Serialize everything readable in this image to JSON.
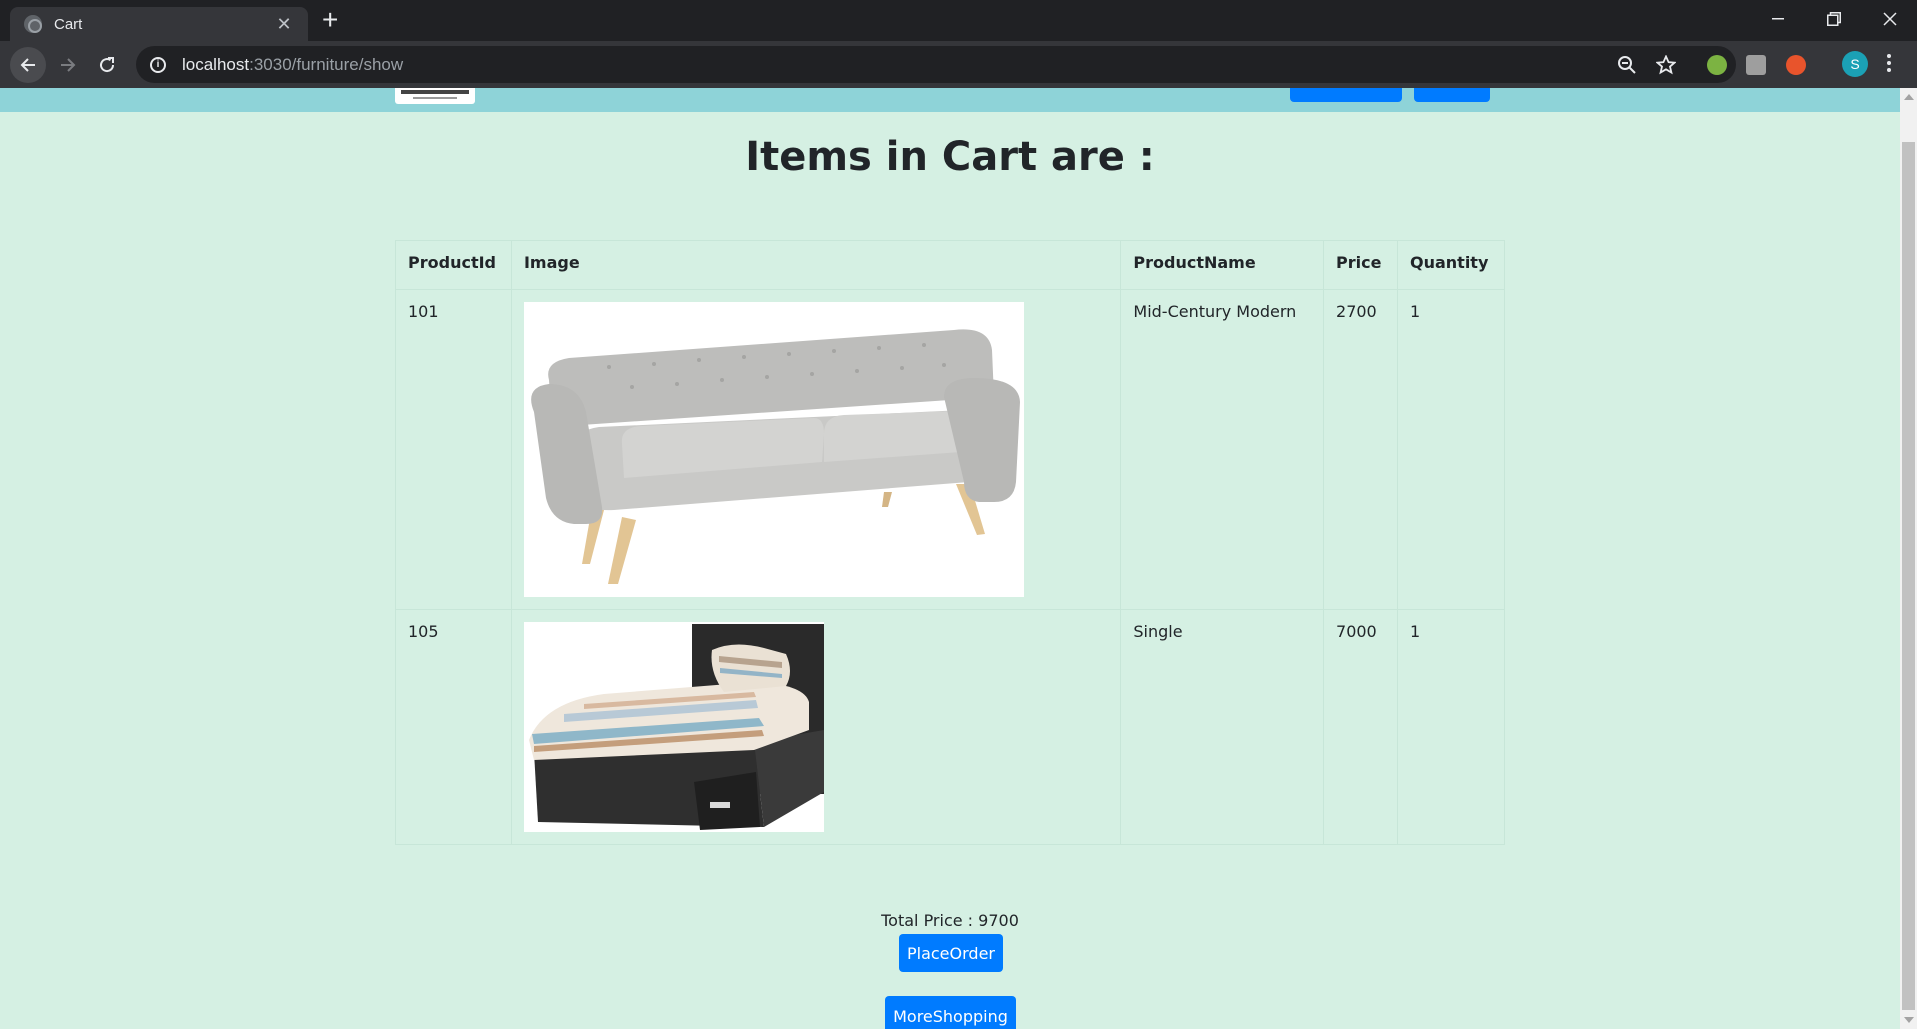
{
  "browser": {
    "tab_title": "Cart",
    "tab_close": "✕",
    "new_tab": "+",
    "url_host": "localhost",
    "url_path": ":3030/furniture/show",
    "avatar_letter": "S"
  },
  "page": {
    "title": "Items in Cart are :",
    "table": {
      "headers": [
        "ProductId",
        "Image",
        "ProductName",
        "Price",
        "Quantity"
      ],
      "rows": [
        {
          "id": "101",
          "image": "sofa-image",
          "name": "Mid-Century Modern",
          "price": "2700",
          "quantity": "1"
        },
        {
          "id": "105",
          "image": "bed-image",
          "name": "Single",
          "price": "7000",
          "quantity": "1"
        }
      ]
    },
    "total_price": "Total Price : 9700",
    "place_order_label": "PlaceOrder",
    "more_shopping_label": "MoreShopping"
  },
  "colors": {
    "page_bg": "#d5f0e3",
    "nav_bg": "#8ed3d8",
    "button_bg": "#007bff"
  }
}
